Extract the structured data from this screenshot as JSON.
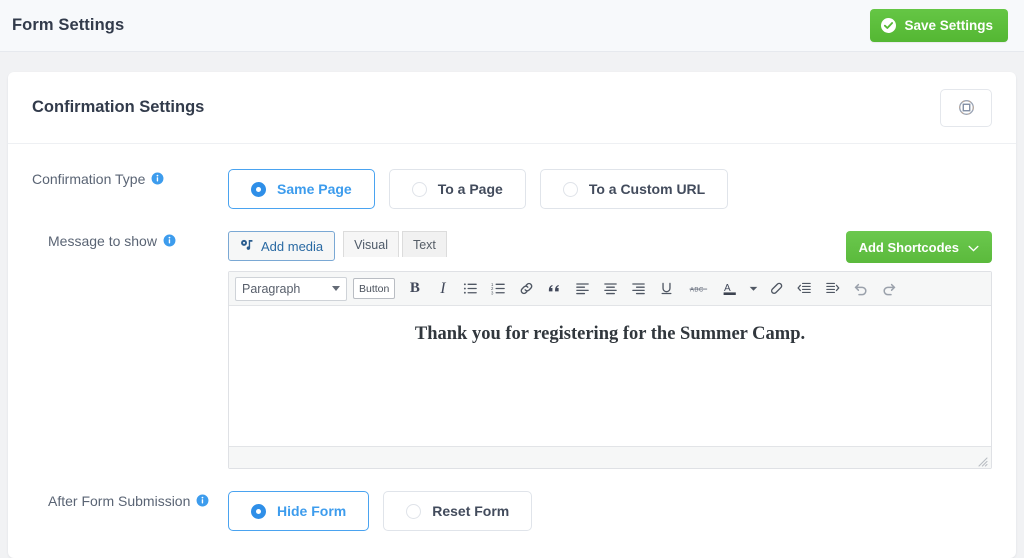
{
  "topbar": {
    "title": "Form Settings",
    "save_label": "Save Settings",
    "save_icon": "check-circle-icon",
    "accent_green": "#5bbf3c"
  },
  "card": {
    "title": "Confirmation Settings",
    "header_icon": "globe-settings-icon"
  },
  "rows": {
    "confirmation_type": {
      "label": "Confirmation Type",
      "info_icon": "info-icon",
      "options": [
        {
          "label": "Same Page",
          "selected": true
        },
        {
          "label": "To a Page",
          "selected": false
        },
        {
          "label": "To a Custom URL",
          "selected": false
        }
      ]
    },
    "message_to_show": {
      "label": "Message to show",
      "info_icon": "info-icon",
      "add_media_label": "Add media",
      "add_media_icon": "media-icon",
      "tabs": [
        {
          "label": "Visual",
          "active": true
        },
        {
          "label": "Text",
          "active": false
        }
      ],
      "shortcodes_label": "Add Shortcodes",
      "shortcodes_icon": "chevron-down-icon",
      "editor": {
        "format_select": "Paragraph",
        "button_tool_label": "Button",
        "tools": [
          "bold-icon",
          "italic-icon",
          "bulleted-list-icon",
          "numbered-list-icon",
          "link-icon",
          "blockquote-icon",
          "align-left-icon",
          "align-center-icon",
          "align-right-icon",
          "underline-icon",
          "strikethrough-icon",
          "text-color-icon",
          "text-color-dropdown-icon",
          "clear-formatting-icon",
          "decrease-indent-icon",
          "increase-indent-icon",
          "undo-icon",
          "redo-icon"
        ],
        "content": "Thank you for registering for the Summer Camp."
      }
    },
    "after_form_submission": {
      "label": "After Form Submission",
      "info_icon": "info-icon",
      "options": [
        {
          "label": "Hide Form",
          "selected": true
        },
        {
          "label": "Reset Form",
          "selected": false
        }
      ]
    }
  }
}
